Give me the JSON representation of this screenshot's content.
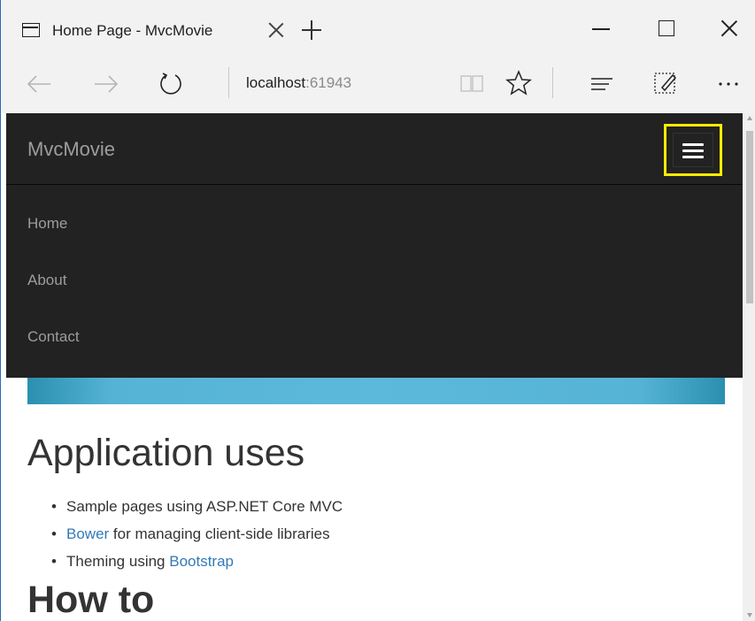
{
  "browser": {
    "tab_title": "Home Page - MvcMovie",
    "url_host": "localhost",
    "url_port": ":61943"
  },
  "site": {
    "brand": "MvcMovie",
    "menu_items": [
      "Home",
      "About",
      "Contact"
    ]
  },
  "content": {
    "heading": "Application uses",
    "bullets": [
      {
        "prefix": "Sample pages using ASP.NET Core MVC",
        "link": "",
        "suffix": ""
      },
      {
        "prefix": "",
        "link": "Bower",
        "suffix": " for managing client-side libraries"
      },
      {
        "prefix": "Theming using ",
        "link": "Bootstrap",
        "suffix": ""
      }
    ],
    "next_heading_partial": "How to"
  },
  "colors": {
    "navbar_bg": "#222222",
    "menu_text": "#9d9d9d",
    "highlight": "#ffeb00",
    "link": "#337ab7",
    "carousel": "#5db9db"
  }
}
